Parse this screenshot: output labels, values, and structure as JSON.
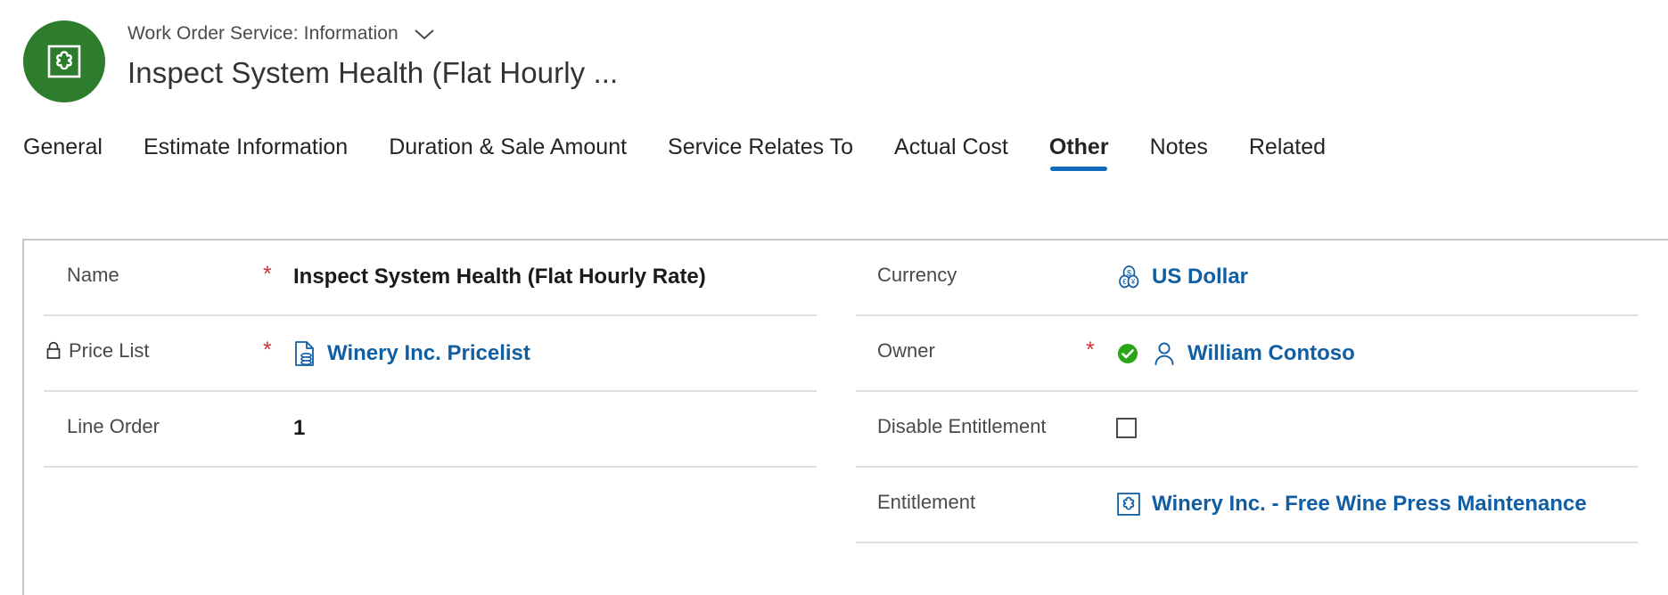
{
  "header": {
    "avatar_icon": "entitlement-puzzle-icon",
    "subtitle": "Work Order Service: Information",
    "chevron_icon": "chevron-down-icon",
    "title": "Inspect System Health (Flat Hourly ...",
    "avatar_color": "#2d7d2d"
  },
  "tabs": [
    {
      "label": "General",
      "active": false
    },
    {
      "label": "Estimate Information",
      "active": false
    },
    {
      "label": "Duration & Sale Amount",
      "active": false
    },
    {
      "label": "Service Relates To",
      "active": false
    },
    {
      "label": "Actual Cost",
      "active": false
    },
    {
      "label": "Other",
      "active": true
    },
    {
      "label": "Notes",
      "active": false
    },
    {
      "label": "Related",
      "active": false
    }
  ],
  "accent_color": "#0f6cbd",
  "link_color": "#115ea3",
  "required_color": "#d13438",
  "form": {
    "left_column": [
      {
        "label": "Name",
        "required": true,
        "locked": false,
        "value": "Inspect System Health (Flat Hourly Rate)",
        "value_type": "text",
        "icon": null
      },
      {
        "label": "Price List",
        "required": true,
        "locked": true,
        "lock_icon": "lock-icon",
        "value": "Winery Inc. Pricelist",
        "value_type": "link",
        "icon": "price-list-icon"
      },
      {
        "label": "Line Order",
        "required": false,
        "locked": false,
        "value": "1",
        "value_type": "number",
        "icon": null
      }
    ],
    "right_column": [
      {
        "label": "Currency",
        "required": false,
        "locked": false,
        "value": "US Dollar",
        "value_type": "link",
        "icon": "currency-icon"
      },
      {
        "label": "Owner",
        "required": true,
        "locked": false,
        "value": "William Contoso",
        "value_type": "link",
        "icon": "person-icon",
        "status_icon": "green-check-icon",
        "status_color": "#2aa515"
      },
      {
        "label": "Disable Entitlement",
        "required": false,
        "locked": false,
        "value": "",
        "value_type": "checkbox",
        "checked": false,
        "icon": null
      },
      {
        "label": "Entitlement",
        "required": false,
        "locked": false,
        "value": "Winery Inc. - Free Wine Press Maintenance",
        "value_type": "link",
        "icon": "entitlement-puzzle-icon"
      }
    ]
  }
}
